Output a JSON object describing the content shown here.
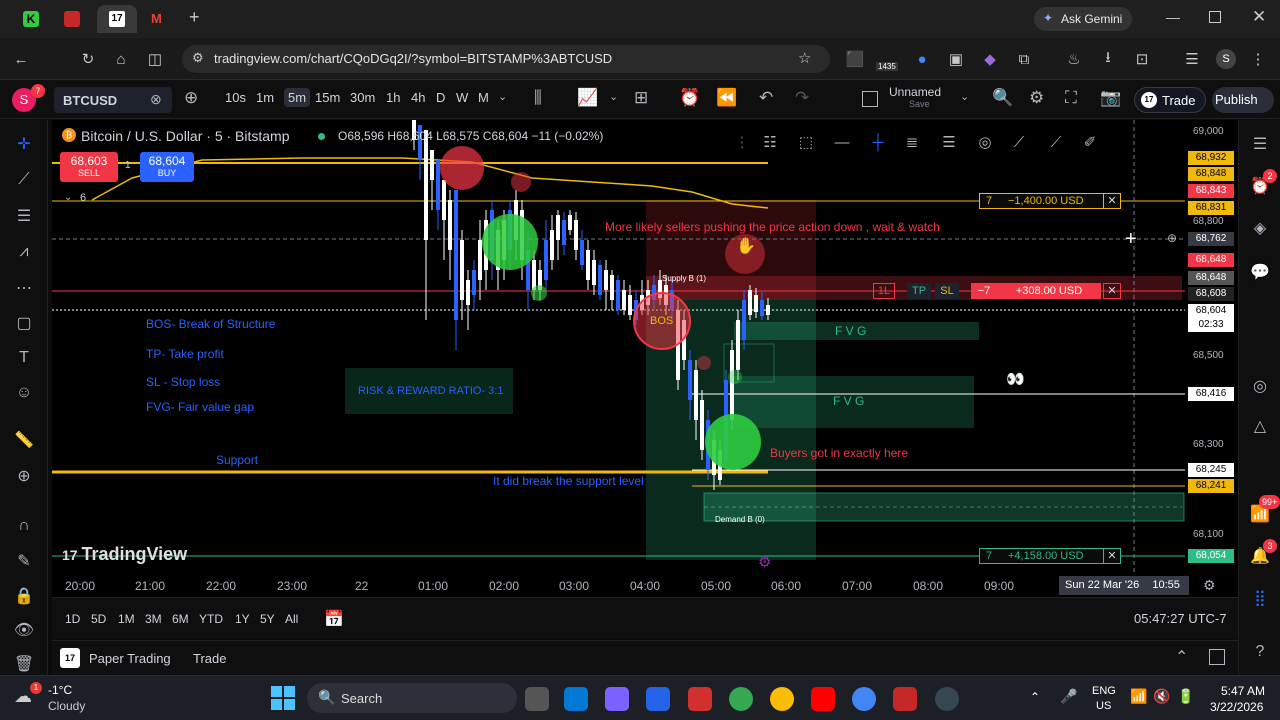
{
  "browser": {
    "url": "tradingview.com/chart/CQoDGq2I/?symbol=BITSTAMP%3ABTCUSD",
    "ask_gemini": "Ask Gemini",
    "ext_badge": "1435"
  },
  "toolbar": {
    "symbol": "BTCUSD",
    "timeframes": [
      "10s",
      "1m",
      "5m",
      "15m",
      "30m",
      "1h",
      "4h",
      "D",
      "W",
      "M"
    ],
    "active_tf": "5m",
    "layout_name": "Unnamed",
    "layout_sub": "Save",
    "trade_label": "Trade",
    "publish_label": "Publish",
    "avatar_letter": "S",
    "avatar_badge": "7"
  },
  "legend": {
    "title": "Bitcoin / U.S. Dollar · 5 · Bitstamp",
    "ohlc": "O68,596 H68,604 L68,575 C68,604 −11 (−0.02%)",
    "sell_price": "68,603",
    "sell_label": "SELL",
    "buy_price": "68,604",
    "buy_label": "BUY",
    "spread": "1",
    "collapse_count": "6"
  },
  "annotations": {
    "bos": "BOS- Break of Structure",
    "tp": "TP- Take profit",
    "sl": "SL - Stop loss",
    "fvg_def": "FVG- Fair value gap",
    "support": "Support",
    "rr": "RISK & REWARD RATIO- 3:1",
    "sellers": "More likely sellers pushing the price action down , wait & watch",
    "buyers": "Buyers got in exactly here",
    "break": "It did break the support level",
    "fvg1": "F V G",
    "fvg2": "F V G",
    "supply": "Supply B (1)",
    "demand": "Demand B (0)",
    "bos_tag": "BOS",
    "watermark": "TradingView"
  },
  "orders": {
    "sl_line": {
      "qty": "7",
      "pnl": "−1,400.00 USD"
    },
    "pos_line": {
      "qty": "1L",
      "tp": "TP",
      "sl": "SL",
      "count": "−7",
      "pnl": "+308.00 USD"
    },
    "tp_line": {
      "qty": "7",
      "pnl": "+4,158.00 USD"
    }
  },
  "price_axis": {
    "ticks": [
      "69,000",
      "68,800",
      "68,500",
      "68,300",
      "68,100"
    ],
    "labels": [
      {
        "text": "68,932",
        "color": "#f0b90b",
        "fg": "#000"
      },
      {
        "text": "68,848",
        "color": "#f0b90b",
        "fg": "#000"
      },
      {
        "text": "68,843",
        "color": "#f23645",
        "fg": "#fff"
      },
      {
        "text": "68,831",
        "color": "#f0b90b",
        "fg": "#000"
      },
      {
        "text": "68,762",
        "color": "#363a45",
        "fg": "#fff"
      },
      {
        "text": "68,648",
        "color": "#f23645",
        "fg": "#fff"
      },
      {
        "text": "68,648",
        "color": "#555",
        "fg": "#fff"
      },
      {
        "text": "68,608",
        "color": "#222",
        "fg": "#fff"
      },
      {
        "text": "68,604",
        "color": "#ffffff",
        "fg": "#000"
      },
      {
        "text": "02:33",
        "color": "#ffffff",
        "fg": "#000"
      },
      {
        "text": "68,416",
        "color": "#ffffff",
        "fg": "#000"
      },
      {
        "text": "68,245",
        "color": "#ffffff",
        "fg": "#000"
      },
      {
        "text": "68,241",
        "color": "#f0b90b",
        "fg": "#000"
      },
      {
        "text": "68,054",
        "color": "#2ebd85",
        "fg": "#fff"
      }
    ]
  },
  "time_axis": {
    "ticks": [
      "20:00",
      "21:00",
      "22:00",
      "23:00",
      "22",
      "01:00",
      "02:00",
      "03:00",
      "04:00",
      "05:00",
      "06:00",
      "07:00",
      "08:00",
      "09:00"
    ],
    "cursor_label": "Sun 22 Mar '26",
    "cursor_time": "10:55"
  },
  "ranges": {
    "items": [
      "1D",
      "5D",
      "1M",
      "3M",
      "6M",
      "YTD",
      "1Y",
      "5Y",
      "All"
    ],
    "clock": "05:47:27 UTC-7"
  },
  "paper": {
    "label": "Paper Trading",
    "trade": "Trade"
  },
  "taskbar": {
    "weather_temp": "-1°C",
    "weather_desc": "Cloudy",
    "search": "Search",
    "lang1": "ENG",
    "lang2": "US",
    "time": "5:47 AM",
    "date": "3/22/2026"
  },
  "badges": {
    "alerts": "2",
    "notifications": "99+",
    "bell": "3"
  }
}
